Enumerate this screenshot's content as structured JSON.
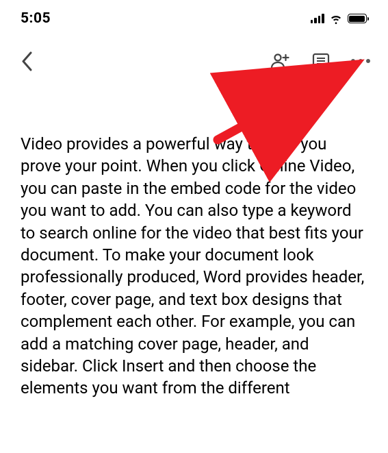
{
  "status": {
    "time": "5:05"
  },
  "document": {
    "body": "Video provides a powerful way to help you prove your point. When you click Online Video, you can paste in the embed code for the video you want to add. You can also type a keyword to search online for the video that best fits your document. To make your document look professionally produced, Word provides header, footer, cover page, and text box designs that complement each other. For example, you can add a matching cover page, header, and sidebar. Click Insert and then choose the elements you want from the different"
  },
  "annotation": {
    "color": "#ed1c24"
  }
}
